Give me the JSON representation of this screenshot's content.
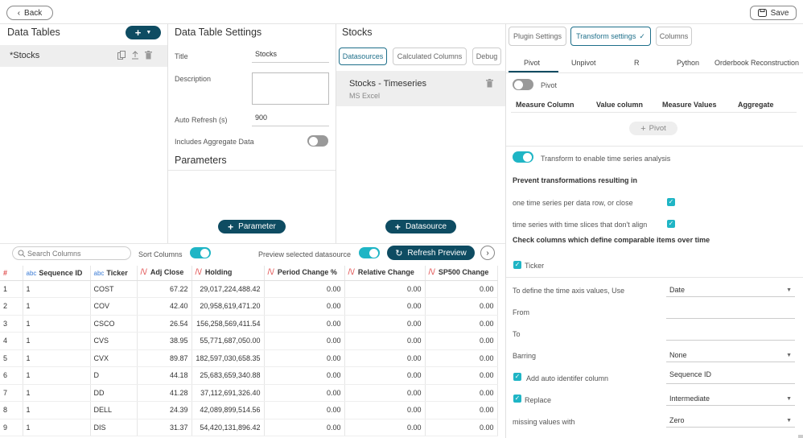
{
  "topbar": {
    "back_label": "Back",
    "save_label": "Save"
  },
  "data_tables": {
    "title": "Data Tables",
    "add_label": "+",
    "items": [
      {
        "label": "*Stocks"
      }
    ]
  },
  "settings": {
    "title": "Data Table Settings",
    "title_label": "Title",
    "title_value": "Stocks",
    "description_label": "Description",
    "description_value": "",
    "auto_refresh_label": "Auto Refresh (s)",
    "auto_refresh_value": "900",
    "aggregate_label": "Includes Aggregate Data",
    "parameters_title": "Parameters",
    "parameter_button": "Parameter"
  },
  "stocks_panel": {
    "title": "Stocks",
    "tabs": [
      "Datasources",
      "Calculated Columns",
      "Debug"
    ],
    "datasource_name": "Stocks - Timeseries",
    "datasource_type": "MS Excel",
    "datasource_button": "Datasource"
  },
  "right_panel": {
    "top_tabs": [
      "Plugin Settings",
      "Transform settings",
      "Columns"
    ],
    "active_top_tab_check": "✓",
    "sub_tabs": [
      "Pivot",
      "Unpivot",
      "R",
      "Python",
      "Orderbook Reconstruction"
    ],
    "pivot_label": "Pivot",
    "pivot_columns": [
      "Measure Column",
      "Value column",
      "Measure Values",
      "Aggregate"
    ],
    "pivot_button": "Pivot",
    "time_series_label": "Transform to enable time series analysis",
    "prevent_title": "Prevent transformations resulting in",
    "prevent_1": "one time series per data row, or close",
    "prevent_2": "time series with time slices that don't align",
    "check_title": "Check columns which define comparable items over time",
    "ticker_label": "Ticker",
    "time_axis_label": "To define the time axis values, Use",
    "time_axis_value": "Date",
    "from_label": "From",
    "to_label": "To",
    "barring_label": "Barring",
    "barring_value": "None",
    "auto_id_label": "Add auto identifer column",
    "auto_id_value": "Sequence ID",
    "replace_label": "Replace",
    "replace_value": "Intermediate",
    "missing_label": "missing values with",
    "missing_value": "Zero"
  },
  "preview": {
    "search_placeholder": "Search Columns",
    "sort_label": "Sort Columns",
    "preview_label": "Preview selected datasource",
    "refresh_label": "Refresh Preview",
    "columns": [
      {
        "name": "#",
        "type": ""
      },
      {
        "name": "Sequence ID",
        "type": "abc"
      },
      {
        "name": "Ticker",
        "type": "abc"
      },
      {
        "name": "Adj Close",
        "type": "num"
      },
      {
        "name": "Holding",
        "type": "num"
      },
      {
        "name": "Period Change %",
        "type": "num"
      },
      {
        "name": "Relative Change",
        "type": "num"
      },
      {
        "name": "SP500 Change",
        "type": "num"
      }
    ],
    "rows": [
      [
        "1",
        "1",
        "COST",
        "67.22",
        "29,017,224,488.42",
        "0.00",
        "0.00",
        "0.00"
      ],
      [
        "2",
        "1",
        "COV",
        "42.40",
        "20,958,619,471.20",
        "0.00",
        "0.00",
        "0.00"
      ],
      [
        "3",
        "1",
        "CSCO",
        "26.54",
        "156,258,569,411.54",
        "0.00",
        "0.00",
        "0.00"
      ],
      [
        "4",
        "1",
        "CVS",
        "38.95",
        "55,771,687,050.00",
        "0.00",
        "0.00",
        "0.00"
      ],
      [
        "5",
        "1",
        "CVX",
        "89.87",
        "182,597,030,658.35",
        "0.00",
        "0.00",
        "0.00"
      ],
      [
        "6",
        "1",
        "D",
        "44.18",
        "25,683,659,340.88",
        "0.00",
        "0.00",
        "0.00"
      ],
      [
        "7",
        "1",
        "DD",
        "41.28",
        "37,112,691,326.40",
        "0.00",
        "0.00",
        "0.00"
      ],
      [
        "8",
        "1",
        "DELL",
        "24.39",
        "42,089,899,514.56",
        "0.00",
        "0.00",
        "0.00"
      ],
      [
        "9",
        "1",
        "DIS",
        "31.37",
        "54,420,131,896.42",
        "0.00",
        "0.00",
        "0.00"
      ]
    ]
  },
  "colors": {
    "accent": "#0e4c62",
    "toggle_on": "#1fb5c5",
    "numeric_icon": "#e04a4a",
    "text_icon": "#3a7bd5"
  }
}
